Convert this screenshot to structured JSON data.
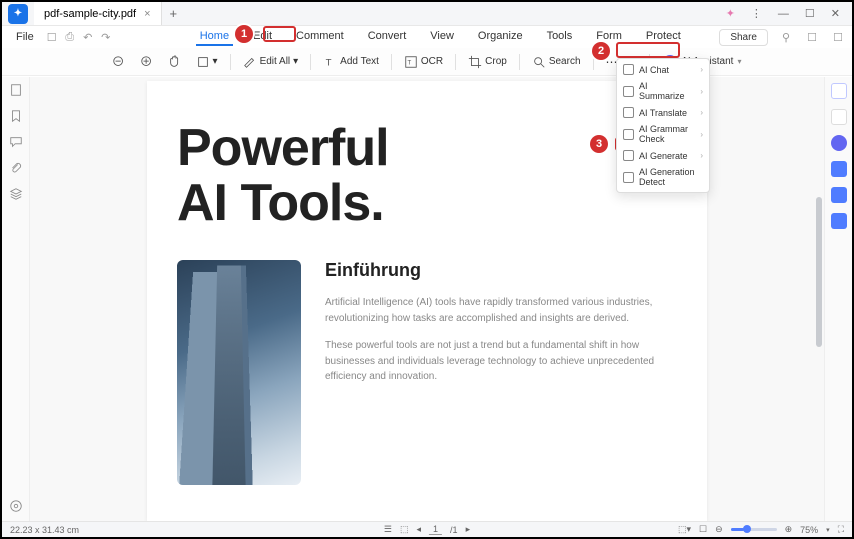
{
  "titlebar": {
    "filename": "pdf-sample-city.pdf",
    "close_x": "×",
    "add": "+"
  },
  "menu": {
    "file": "File",
    "tabs": [
      "Home",
      "Edit",
      "Comment",
      "Convert",
      "View",
      "Organize",
      "Tools",
      "Form",
      "Protect"
    ],
    "active_index": 0,
    "share": "Share"
  },
  "toolbar": {
    "edit_all": "Edit All",
    "add_text": "Add Text",
    "ocr": "OCR",
    "crop": "Crop",
    "search": "Search",
    "more": "M...",
    "ai_assistant": "AI Assistant",
    "ai_badge": "AI"
  },
  "ai_menu": {
    "items": [
      {
        "label": "AI Chat",
        "sub": true
      },
      {
        "label": "AI Summarize",
        "sub": true
      },
      {
        "label": "AI Translate",
        "sub": true
      },
      {
        "label": "AI Grammar Check",
        "sub": true
      },
      {
        "label": "AI Generate",
        "sub": true
      },
      {
        "label": "AI Generation Detect",
        "sub": false
      }
    ]
  },
  "doc": {
    "title_l1": "Powerful",
    "title_l2": "AI Tools.",
    "subhead": "Einführung",
    "para1": "Artificial Intelligence (AI) tools have rapidly transformed various industries, revolutionizing how tasks are accomplished and insights are derived.",
    "para2": "These powerful tools are not just a trend but a fundamental shift in how businesses and individuals leverage technology to achieve unprecedented efficiency and innovation."
  },
  "status": {
    "dims": "22.23 x 31.43 cm",
    "page_current": "1",
    "page_total": "/1",
    "zoom": "75%"
  },
  "annotations": {
    "p1": "1",
    "p2": "2",
    "p3": "3"
  }
}
